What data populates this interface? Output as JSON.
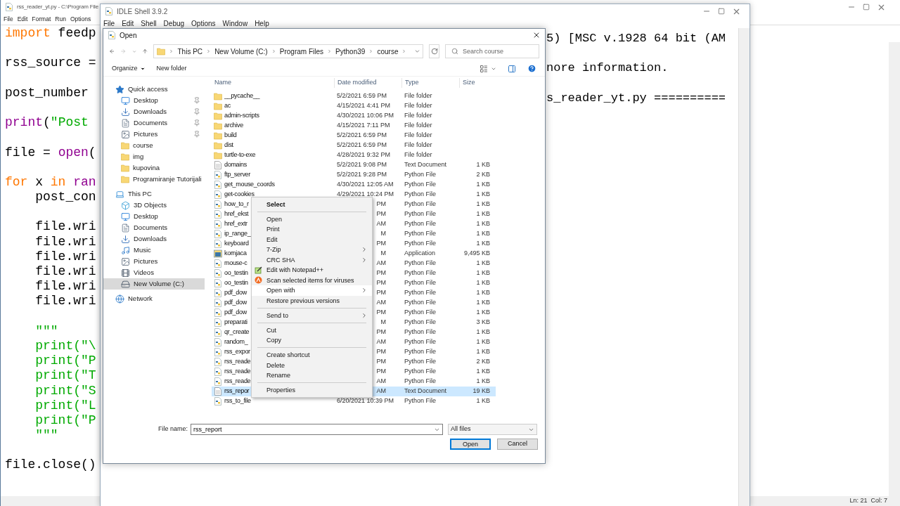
{
  "editor": {
    "title": "rss_reader_yt.py - C:\\Program File",
    "menu": [
      "File",
      "Edit",
      "Format",
      "Run",
      "Options"
    ],
    "lines": [
      {
        "kind": "code",
        "segments": [
          {
            "text": "import",
            "kind": "keyword"
          },
          {
            "text": " feedp",
            "kind": "plain"
          }
        ]
      },
      {
        "kind": "blank"
      },
      {
        "kind": "code",
        "segments": [
          {
            "text": "rss_source =",
            "kind": "plain"
          }
        ]
      },
      {
        "kind": "blank"
      },
      {
        "kind": "code",
        "segments": [
          {
            "text": "post_number",
            "kind": "plain"
          }
        ]
      },
      {
        "kind": "blank"
      },
      {
        "kind": "code",
        "segments": [
          {
            "text": "print",
            "kind": "builtin"
          },
          {
            "text": "(",
            "kind": "plain"
          },
          {
            "text": "\"Post",
            "kind": "string"
          }
        ]
      },
      {
        "kind": "blank"
      },
      {
        "kind": "code",
        "segments": [
          {
            "text": "file = ",
            "kind": "plain"
          },
          {
            "text": "open",
            "kind": "builtin"
          },
          {
            "text": "(",
            "kind": "plain"
          }
        ]
      },
      {
        "kind": "blank"
      },
      {
        "kind": "code",
        "segments": [
          {
            "text": "for",
            "kind": "keyword"
          },
          {
            "text": " x ",
            "kind": "plain"
          },
          {
            "text": "in",
            "kind": "keyword"
          },
          {
            "text": " ran",
            "kind": "builtin"
          }
        ]
      },
      {
        "kind": "code",
        "segments": [
          {
            "text": "    post_con",
            "kind": "plain"
          }
        ]
      },
      {
        "kind": "blank"
      },
      {
        "kind": "code",
        "segments": [
          {
            "text": "    file.wri",
            "kind": "plain"
          }
        ]
      },
      {
        "kind": "code",
        "segments": [
          {
            "text": "    file.wri",
            "kind": "plain"
          }
        ]
      },
      {
        "kind": "code",
        "segments": [
          {
            "text": "    file.wri",
            "kind": "plain"
          }
        ]
      },
      {
        "kind": "code",
        "segments": [
          {
            "text": "    file.wri",
            "kind": "plain"
          }
        ]
      },
      {
        "kind": "code",
        "segments": [
          {
            "text": "    file.wri",
            "kind": "plain"
          }
        ]
      },
      {
        "kind": "code",
        "segments": [
          {
            "text": "    file.wri",
            "kind": "plain"
          }
        ]
      },
      {
        "kind": "blank"
      },
      {
        "kind": "code",
        "segments": [
          {
            "text": "    \"\"\"",
            "kind": "string"
          }
        ]
      },
      {
        "kind": "code",
        "segments": [
          {
            "text": "    print(\"\\",
            "kind": "string"
          }
        ]
      },
      {
        "kind": "code",
        "segments": [
          {
            "text": "    print(\"P",
            "kind": "string"
          }
        ]
      },
      {
        "kind": "code",
        "segments": [
          {
            "text": "    print(\"T",
            "kind": "string"
          }
        ]
      },
      {
        "kind": "code",
        "segments": [
          {
            "text": "    print(\"S",
            "kind": "string"
          }
        ]
      },
      {
        "kind": "code",
        "segments": [
          {
            "text": "    print(\"L",
            "kind": "string"
          }
        ]
      },
      {
        "kind": "code",
        "segments": [
          {
            "text": "    print(\"P",
            "kind": "string"
          }
        ]
      },
      {
        "kind": "code",
        "segments": [
          {
            "text": "    \"\"\"",
            "kind": "string"
          }
        ]
      },
      {
        "kind": "blank"
      },
      {
        "kind": "code",
        "segments": [
          {
            "text": "file.close()",
            "kind": "plain"
          }
        ]
      }
    ],
    "status": "Ln: 21  Col: 7"
  },
  "shell": {
    "title": "IDLE Shell 3.9.2",
    "menu": [
      "File",
      "Edit",
      "Shell",
      "Debug",
      "Options",
      "Window",
      "Help"
    ],
    "lines": [
      {
        "kind": "code",
        "text": "5) [MSC v.1928 64 bit (AM"
      },
      {
        "kind": "blank"
      },
      {
        "kind": "code",
        "text": "nore information."
      },
      {
        "kind": "blank"
      },
      {
        "kind": "code",
        "text": "s_reader_yt.py =========="
      }
    ]
  },
  "dialog": {
    "title": "Open",
    "breadcrumb": [
      "This PC",
      "New Volume (C:)",
      "Program Files",
      "Python39",
      "course"
    ],
    "search": {
      "placeholder": "Search course"
    },
    "toolbar": [
      "Organize",
      "New folder"
    ],
    "nav": [
      {
        "label": "Quick access",
        "kind": "star",
        "selected": false,
        "children": [
          {
            "label": "Desktop",
            "kind": "desktop",
            "pinned": true,
            "selected": false
          },
          {
            "label": "Downloads",
            "kind": "downloads",
            "pinned": true,
            "selected": false
          },
          {
            "label": "Documents",
            "kind": "documents",
            "pinned": true,
            "selected": false
          },
          {
            "label": "Pictures",
            "kind": "pictures",
            "pinned": true,
            "selected": false
          },
          {
            "label": "course",
            "kind": "folder",
            "pinned": false,
            "selected": false
          },
          {
            "label": "img",
            "kind": "folder",
            "pinned": false,
            "selected": false
          },
          {
            "label": "kupovina",
            "kind": "folder",
            "pinned": false,
            "selected": false
          },
          {
            "label": "Programiranje Tutorijali",
            "kind": "folder",
            "pinned": false,
            "selected": false
          }
        ]
      },
      {
        "label": "This PC",
        "kind": "pc",
        "selected": false,
        "children": [
          {
            "label": "3D Objects",
            "kind": "objects",
            "pinned": false,
            "selected": false
          },
          {
            "label": "Desktop",
            "kind": "desktop",
            "pinned": false,
            "selected": false
          },
          {
            "label": "Documents",
            "kind": "documents",
            "pinned": false,
            "selected": false
          },
          {
            "label": "Downloads",
            "kind": "downloads",
            "pinned": false,
            "selected": false
          },
          {
            "label": "Music",
            "kind": "music",
            "pinned": false,
            "selected": false
          },
          {
            "label": "Pictures",
            "kind": "pictures",
            "pinned": false,
            "selected": false
          },
          {
            "label": "Videos",
            "kind": "videos",
            "pinned": false,
            "selected": false
          },
          {
            "label": "New Volume (C:)",
            "kind": "drive",
            "pinned": false,
            "selected": true
          }
        ]
      },
      {
        "label": "Network",
        "kind": "network",
        "selected": false
      }
    ],
    "columns": [
      "Name",
      "Date modified",
      "Type",
      "Size"
    ],
    "rows": [
      {
        "name": "__pycache__",
        "date": "5/2/2021 6:59 PM",
        "type": "File folder",
        "kind": "folder",
        "selected": false
      },
      {
        "name": "ac",
        "date": "4/15/2021 4:41 PM",
        "type": "File folder",
        "kind": "folder",
        "selected": false
      },
      {
        "name": "admin-scripts",
        "date": "4/30/2021 10:06 PM",
        "type": "File folder",
        "kind": "folder",
        "selected": false
      },
      {
        "name": "archive",
        "date": "4/15/2021 7:11 PM",
        "type": "File folder",
        "kind": "folder",
        "selected": false
      },
      {
        "name": "build",
        "date": "5/2/2021 6:59 PM",
        "type": "File folder",
        "kind": "folder",
        "selected": false
      },
      {
        "name": "dist",
        "date": "5/2/2021 6:59 PM",
        "type": "File folder",
        "kind": "folder",
        "selected": false
      },
      {
        "name": "turtle-to-exe",
        "date": "4/28/2021 9:32 PM",
        "type": "File folder",
        "kind": "folder",
        "selected": false
      },
      {
        "name": "domains",
        "date": "5/2/2021 9:08 PM",
        "type": "Text Document",
        "size": "1 KB",
        "kind": "text",
        "selected": false
      },
      {
        "name": "ftp_server",
        "date": "5/2/2021 9:28 PM",
        "type": "Python File",
        "size": "2 KB",
        "kind": "python",
        "selected": false
      },
      {
        "name": "get_mouse_coords",
        "date": "4/30/2021 12:05 AM",
        "type": "Python File",
        "size": "1 KB",
        "kind": "python",
        "selected": false
      },
      {
        "name": "get-cookies",
        "date": "4/29/2021 10:24 PM",
        "type": "Python File",
        "size": "1 KB",
        "kind": "python",
        "selected": false
      },
      {
        "name": "how_to_r",
        "date": "PM",
        "type": "Python File",
        "size": "1 KB",
        "kind": "python",
        "selected": false
      },
      {
        "name": "href_ekst",
        "date": "PM",
        "type": "Python File",
        "size": "1 KB",
        "kind": "python",
        "selected": false
      },
      {
        "name": "href_extr",
        "date": "AM",
        "type": "Python File",
        "size": "1 KB",
        "kind": "python",
        "selected": false
      },
      {
        "name": "ip_range_",
        "date": "M",
        "type": "Python File",
        "size": "1 KB",
        "kind": "python",
        "selected": false
      },
      {
        "name": "keyboard",
        "date": "PM",
        "type": "Python File",
        "size": "1 KB",
        "kind": "python",
        "selected": false
      },
      {
        "name": "kornjaca",
        "date": "M",
        "type": "Application",
        "size": "9,495 KB",
        "kind": "app",
        "selected": false
      },
      {
        "name": "mouse-c",
        "date": "AM",
        "type": "Python File",
        "size": "1 KB",
        "kind": "python",
        "selected": false
      },
      {
        "name": "oo_testin",
        "date": "PM",
        "type": "Python File",
        "size": "1 KB",
        "kind": "python",
        "selected": false
      },
      {
        "name": "oo_testin",
        "date": "PM",
        "type": "Python File",
        "size": "1 KB",
        "kind": "python",
        "selected": false
      },
      {
        "name": "pdf_dow",
        "date": "PM",
        "type": "Python File",
        "size": "1 KB",
        "kind": "python",
        "selected": false
      },
      {
        "name": "pdf_dow",
        "date": "AM",
        "type": "Python File",
        "size": "1 KB",
        "kind": "python",
        "selected": false
      },
      {
        "name": "pdf_dow",
        "date": "PM",
        "type": "Python File",
        "size": "1 KB",
        "kind": "python",
        "selected": false
      },
      {
        "name": "preparati",
        "date": "M",
        "type": "Python File",
        "size": "3 KB",
        "kind": "python",
        "selected": false
      },
      {
        "name": "qr_create",
        "date": "PM",
        "type": "Python File",
        "size": "1 KB",
        "kind": "python",
        "selected": false
      },
      {
        "name": "random_",
        "date": "AM",
        "type": "Python File",
        "size": "1 KB",
        "kind": "python",
        "selected": false
      },
      {
        "name": "rss_expor",
        "date": "PM",
        "type": "Python File",
        "size": "1 KB",
        "kind": "python",
        "selected": false
      },
      {
        "name": "rss_reade",
        "date": "PM",
        "type": "Python File",
        "size": "2 KB",
        "kind": "python",
        "selected": false
      },
      {
        "name": "rss_reade",
        "date": "PM",
        "type": "Python File",
        "size": "1 KB",
        "kind": "python",
        "selected": false
      },
      {
        "name": "rss_reade",
        "date": "AM",
        "type": "Python File",
        "size": "1 KB",
        "kind": "python",
        "selected": false
      },
      {
        "name": "rss_repor",
        "date": "AM",
        "type": "Text Document",
        "size": "19 KB",
        "kind": "text",
        "selected": true
      },
      {
        "name": "rss_to_file",
        "date": "6/20/2021 10:39 PM",
        "type": "Python File",
        "size": "1 KB",
        "kind": "python",
        "selected": false
      }
    ],
    "file_name": {
      "label": "File name:",
      "value": "rss_report"
    },
    "filter": "All files",
    "buttons": [
      {
        "label": "Open",
        "default": true
      },
      {
        "label": "Cancel",
        "default": false
      }
    ]
  },
  "context_menu": [
    {
      "kind": "header",
      "label": "Select"
    },
    {
      "kind": "separator"
    },
    {
      "kind": "item",
      "label": "Open",
      "submenu": false,
      "selected": false
    },
    {
      "kind": "item",
      "label": "Print",
      "submenu": false,
      "selected": false
    },
    {
      "kind": "item",
      "label": "Edit",
      "submenu": false,
      "selected": false
    },
    {
      "kind": "item",
      "label": "7-Zip",
      "submenu": true,
      "selected": false
    },
    {
      "kind": "item",
      "label": "CRC SHA",
      "submenu": true,
      "selected": false
    },
    {
      "kind": "notepad",
      "label": "Edit with Notepad++",
      "submenu": false,
      "selected": false
    },
    {
      "kind": "antivirus",
      "label": "Scan selected items for viruses",
      "submenu": false,
      "selected": false
    },
    {
      "kind": "item",
      "label": "Open with",
      "submenu": true,
      "selected": true
    },
    {
      "kind": "item",
      "label": "Restore previous versions",
      "submenu": false,
      "selected": false
    },
    {
      "kind": "separator"
    },
    {
      "kind": "item",
      "label": "Send to",
      "submenu": true,
      "selected": false
    },
    {
      "kind": "separator"
    },
    {
      "kind": "item",
      "label": "Cut",
      "submenu": false,
      "selected": false
    },
    {
      "kind": "item",
      "label": "Copy",
      "submenu": false,
      "selected": false
    },
    {
      "kind": "separator"
    },
    {
      "kind": "item",
      "label": "Create shortcut",
      "submenu": false,
      "selected": false
    },
    {
      "kind": "item",
      "label": "Delete",
      "submenu": false,
      "selected": false
    },
    {
      "kind": "item",
      "label": "Rename",
      "submenu": false,
      "selected": false
    },
    {
      "kind": "separator"
    },
    {
      "kind": "item",
      "label": "Properties",
      "submenu": false,
      "selected": false
    }
  ]
}
